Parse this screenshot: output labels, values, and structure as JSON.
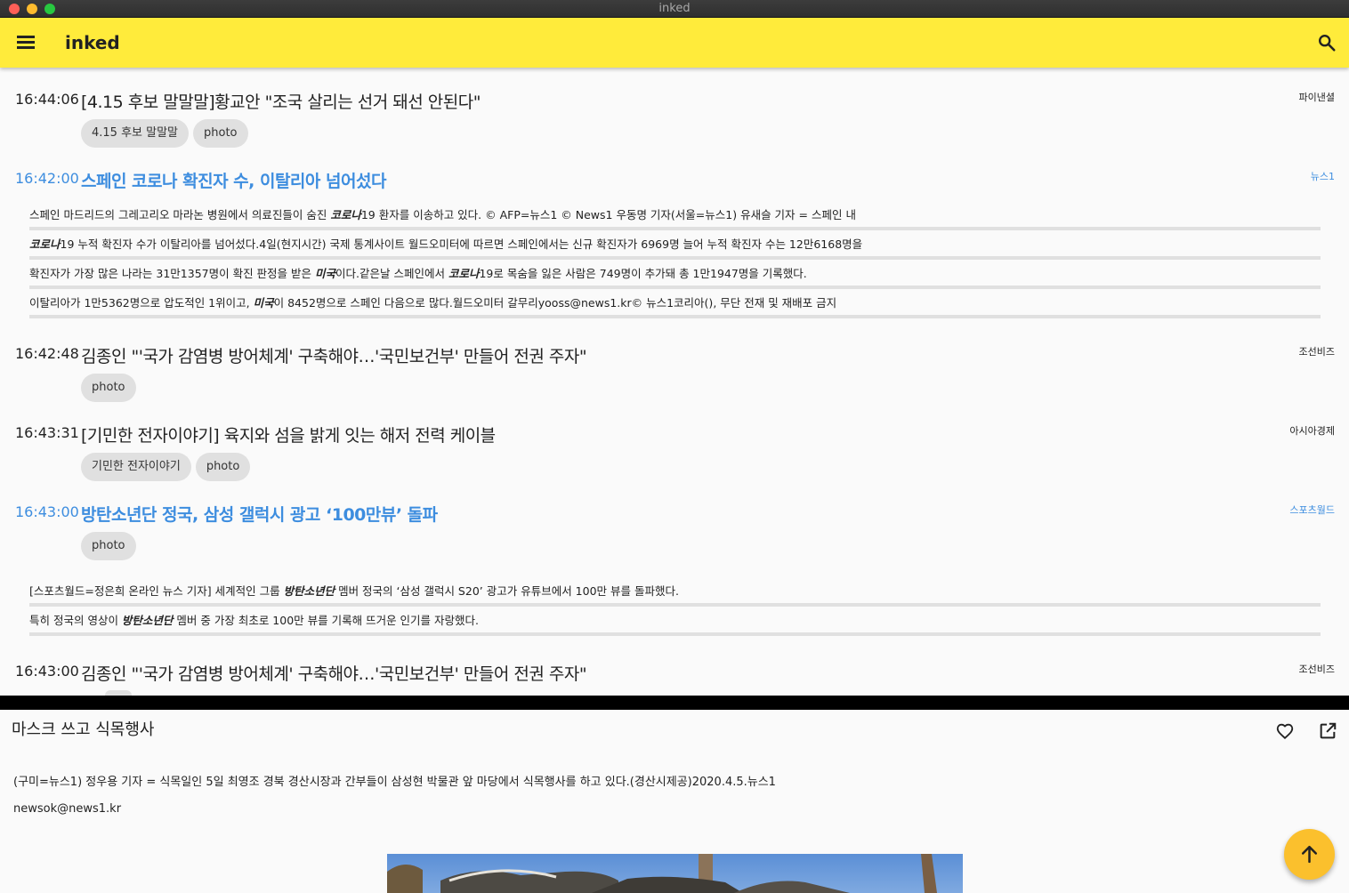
{
  "window": {
    "title": "inked"
  },
  "appbar": {
    "title": "inked"
  },
  "feed": {
    "item1": {
      "time": "16:44:06",
      "headline": "[4.15 후보 말말말]황교안 \"조국 살리는 선거 돼선 안된다\"",
      "source": "파이낸셜",
      "tags": [
        "4.15 후보 말말말",
        "photo"
      ]
    },
    "item2": {
      "time": "16:42:00",
      "headline": "스페인 코로나 확진자 수, 이탈리아 넘어섰다",
      "source": "뉴스1",
      "snippets": [
        {
          "pre": "스페인 마드리드의 그레고리오 마라논 병원에서 의료진들이 숨진 ",
          "kw": "코로나",
          "post": "19 환자를 이송하고 있다. © AFP=뉴스1 © News1 우동명 기자(서울=뉴스1) 유새슬 기자 = 스페인 내"
        },
        {
          "pre": "",
          "kw": "코로나",
          "post": "19 누적 확진자 수가 이탈리아를 넘어섰다.4일(현지시간) 국제 통계사이트 월드오미터에 따르면 스페인에서는 신규 확진자가 6969명 늘어 누적 확진자 수는 12만6168명을"
        },
        {
          "pre": "확진자가 가장 많은 나라는 31만1357명이 확진 판정을 받은 ",
          "kw": "미국",
          "post": "이다.같은날 스페인에서 ",
          "kw2": "코로나",
          "post2": "19로 목숨을 잃은 사람은 749명이 추가돼 총 1만1947명을 기록했다."
        },
        {
          "pre": "이탈리아가 1만5362명으로 압도적인 1위이고, ",
          "kw": "미국",
          "post": "이 8452명으로 스페인 다음으로 많다.월드오미터 갈무리yooss@news1.kr© 뉴스1코리아(), 무단 전재 및 재배포 금지"
        }
      ]
    },
    "item3": {
      "time": "16:42:48",
      "headline": "김종인 \"'국가 감염병 방어체계' 구축해야…'국민보건부' 만들어 전권 주자\"",
      "source": "조선비즈",
      "tags": [
        "photo"
      ]
    },
    "item4": {
      "time": "16:43:31",
      "headline": "[기민한 전자이야기] 육지와 섬을 밝게 잇는 해저 전력 케이블",
      "source": "아시아경제",
      "tags": [
        "기민한 전자이야기",
        "photo"
      ]
    },
    "item5": {
      "time": "16:43:00",
      "headline": "방탄소년단 정국, 삼성 갤럭시 광고 ‘100만뷰’ 돌파",
      "source": "스포츠월드",
      "tags": [
        "photo"
      ],
      "snippets": [
        {
          "pre": "[스포츠월드=정은희 온라인 뉴스 기자] 세계적인 그룹 ",
          "kw": "방탄소년단",
          "post": " 멤버 정국의 ‘삼성 갤럭시 S20’ 광고가 유튜브에서 100만 뷰를 돌파했다."
        },
        {
          "pre": "특히 정국의 영상이 ",
          "kw": "방탄소년단",
          "post": " 멤버 중 가장 최초로 100만 뷰를 기록해 뜨거운 인기를 자랑했다."
        }
      ]
    },
    "item6": {
      "time": "16:43:00",
      "headline": "김종인 \"'국가 감염병 방어체계' 구축해야…'국민보건부' 만들어 전권 주자\"",
      "source": "조선비즈"
    }
  },
  "detail": {
    "title": "마스크 쓰고 식목행사",
    "body": "(구미=뉴스1) 정우용 기자 = 식목일인 5일 최영조 경북 경산시장과 간부들이 삼성현 박물관 앞 마당에서 식목행사를 하고 있다.(경산시제공)2020.4.5.뉴스1",
    "email": "newsok@news1.kr"
  },
  "colors": {
    "appbar": "#ffeb3b",
    "highlight": "#3d8ddf",
    "fab": "#fbc02d"
  },
  "icons": [
    "menu-icon",
    "search-icon",
    "heart-icon",
    "open-in-new-icon",
    "arrow-up-icon"
  ]
}
